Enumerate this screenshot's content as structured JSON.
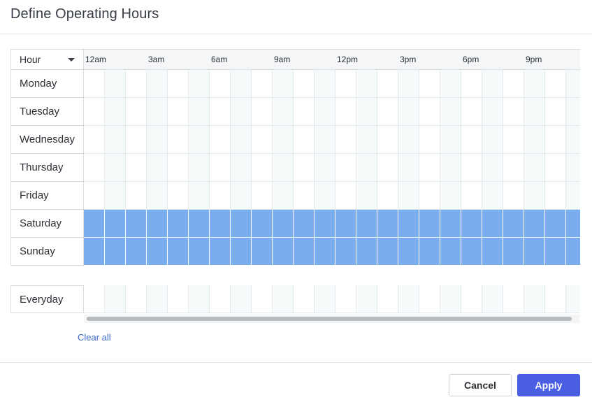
{
  "dialog": {
    "title": "Define Operating Hours"
  },
  "grid": {
    "corner_label": "Hour",
    "hour_labels": [
      "12am",
      "3am",
      "6am",
      "9am",
      "12pm",
      "3pm",
      "6pm",
      "9pm"
    ],
    "days": [
      {
        "label": "Monday",
        "selected": false
      },
      {
        "label": "Tuesday",
        "selected": false
      },
      {
        "label": "Wednesday",
        "selected": false
      },
      {
        "label": "Thursday",
        "selected": false
      },
      {
        "label": "Friday",
        "selected": false
      },
      {
        "label": "Saturday",
        "selected": true
      },
      {
        "label": "Sunday",
        "selected": true
      }
    ],
    "everyday_label": "Everyday",
    "selected_color": "#7aadee"
  },
  "actions": {
    "clear_all": "Clear all",
    "cancel": "Cancel",
    "apply": "Apply",
    "apply_color": "#4a5ee3"
  }
}
